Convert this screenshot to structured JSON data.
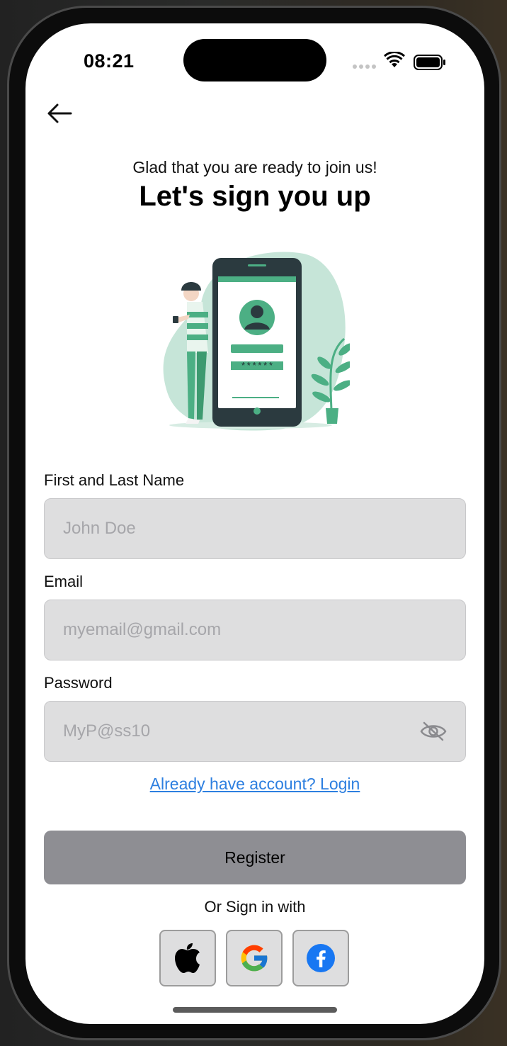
{
  "status_bar": {
    "time": "08:21"
  },
  "header": {
    "subtitle": "Glad that you are ready to join us!",
    "title": "Let's sign you up"
  },
  "form": {
    "name": {
      "label": "First and Last Name",
      "placeholder": "John Doe",
      "value": ""
    },
    "email": {
      "label": "Email",
      "placeholder": "myemail@gmail.com",
      "value": ""
    },
    "password": {
      "label": "Password",
      "placeholder": "MyP@ss10",
      "value": ""
    }
  },
  "illustration": {
    "masked_password": "******"
  },
  "login_link": "Already have account? Login",
  "register_label": "Register",
  "social": {
    "heading": "Or Sign in with",
    "providers": [
      "apple-icon",
      "google-icon",
      "facebook-icon"
    ]
  },
  "colors": {
    "accent": "#4caf84",
    "link": "#2d7fe0",
    "button": "#8e8e93",
    "input_bg": "#dededf"
  }
}
